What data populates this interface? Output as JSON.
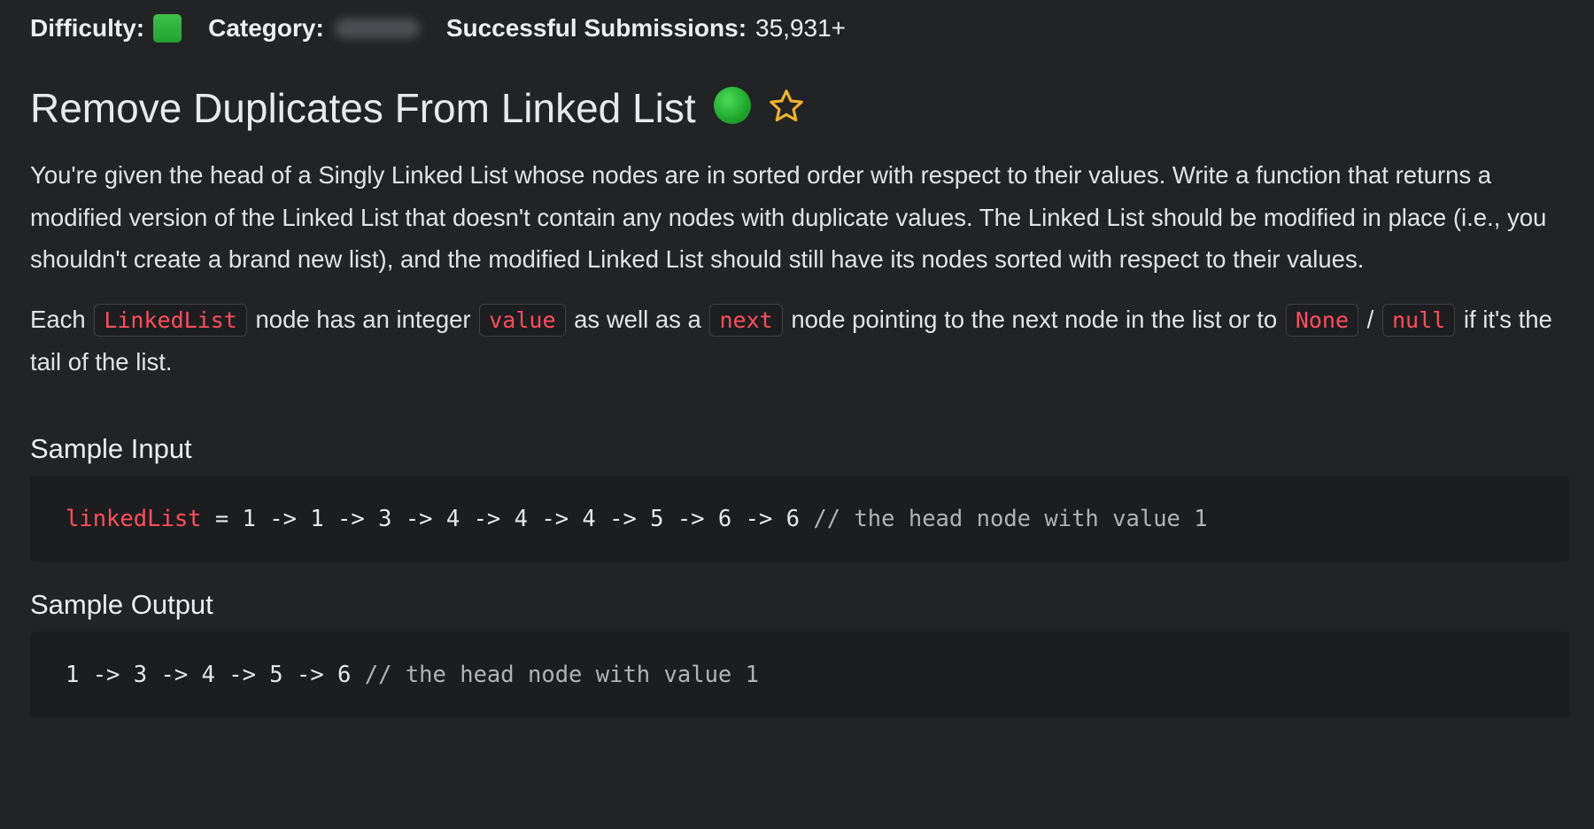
{
  "meta": {
    "difficulty_label": "Difficulty:",
    "category_label": "Category:",
    "submissions_label": "Successful Submissions:",
    "submissions_value": "35,931+",
    "difficulty_color": "#2fb53d"
  },
  "problem": {
    "title": "Remove Duplicates From Linked List",
    "status_icon": "completed-dot-icon",
    "favorite_icon": "star-outline-icon",
    "status_color": "#1fa62b",
    "star_color": "#f0b428"
  },
  "description": {
    "paragraph_1": "You're given the head of a Singly Linked List whose nodes are in sorted order with respect to their values. Write a function that returns a modified version of the Linked List that doesn't contain any nodes with duplicate values. The Linked List should be modified in place (i.e., you shouldn't create a brand new list), and the modified Linked List should still have its nodes sorted with respect to their values.",
    "p2_text_1": "Each ",
    "p2_code_1": "LinkedList",
    "p2_text_2": " node has an integer ",
    "p2_code_2": "value",
    "p2_text_3": " as well as a ",
    "p2_code_3": "next",
    "p2_text_4": " node pointing to the next node in the list or to ",
    "p2_code_4": "None",
    "p2_text_5": " / ",
    "p2_code_5": "null",
    "p2_text_6": " if it's the tail of the list."
  },
  "sample_input": {
    "heading": "Sample Input",
    "var_name": "linkedList",
    "code": " = 1 -> 1 -> 3 -> 4 -> 4 -> 4 -> 5 -> 6 -> 6 ",
    "comment": "// the head node with value 1"
  },
  "sample_output": {
    "heading": "Sample Output",
    "code": "1 -> 3 -> 4 -> 5 -> 6 ",
    "comment": "// the head node with value 1"
  },
  "colors": {
    "background": "#222325",
    "code_background": "#1c1d1f",
    "inline_code_text": "#ff4d5e"
  }
}
